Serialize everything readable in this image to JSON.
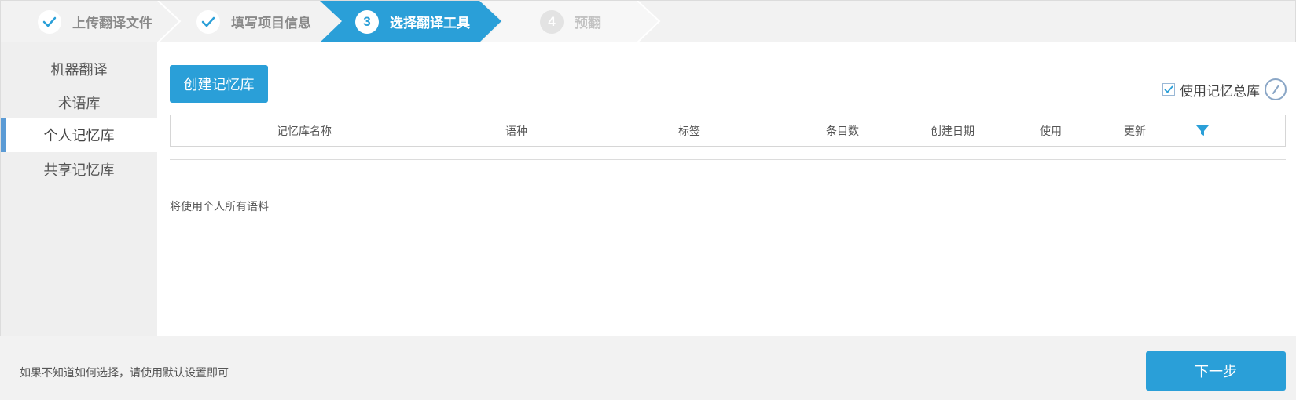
{
  "stepper": {
    "steps": [
      {
        "number": "",
        "label": "上传翻译文件",
        "state": "done"
      },
      {
        "number": "",
        "label": "填写项目信息",
        "state": "done"
      },
      {
        "number": "3",
        "label": "选择翻译工具",
        "state": "active"
      },
      {
        "number": "4",
        "label": "预翻",
        "state": "future"
      }
    ],
    "colors": {
      "active": "#2a9fd8",
      "done_check": "#2a9fd8",
      "bg": "#f2f2f2"
    }
  },
  "sidebar": {
    "items": [
      {
        "label": "机器翻译",
        "active": false
      },
      {
        "label": "术语库",
        "active": false
      },
      {
        "label": "个人记忆库",
        "active": true
      },
      {
        "label": "共享记忆库",
        "active": false
      }
    ]
  },
  "toolbar": {
    "create_label": "创建记忆库",
    "use_total_label": "使用记忆总库",
    "use_total_checked": true,
    "edit_icon": "pencil-circle-icon"
  },
  "table": {
    "headers": [
      "记忆库名称",
      "语种",
      "标签",
      "条目数",
      "创建日期",
      "使用",
      "更新"
    ],
    "filter_icon": "filter-icon",
    "rows": []
  },
  "note": "将使用个人所有语料",
  "footer": {
    "hint": "如果不知道如何选择，请使用默认设置即可",
    "next_label": "下一步"
  },
  "colors": {
    "accent": "#2a9fd8",
    "sidebar_active_bar": "#5b9bd5"
  }
}
